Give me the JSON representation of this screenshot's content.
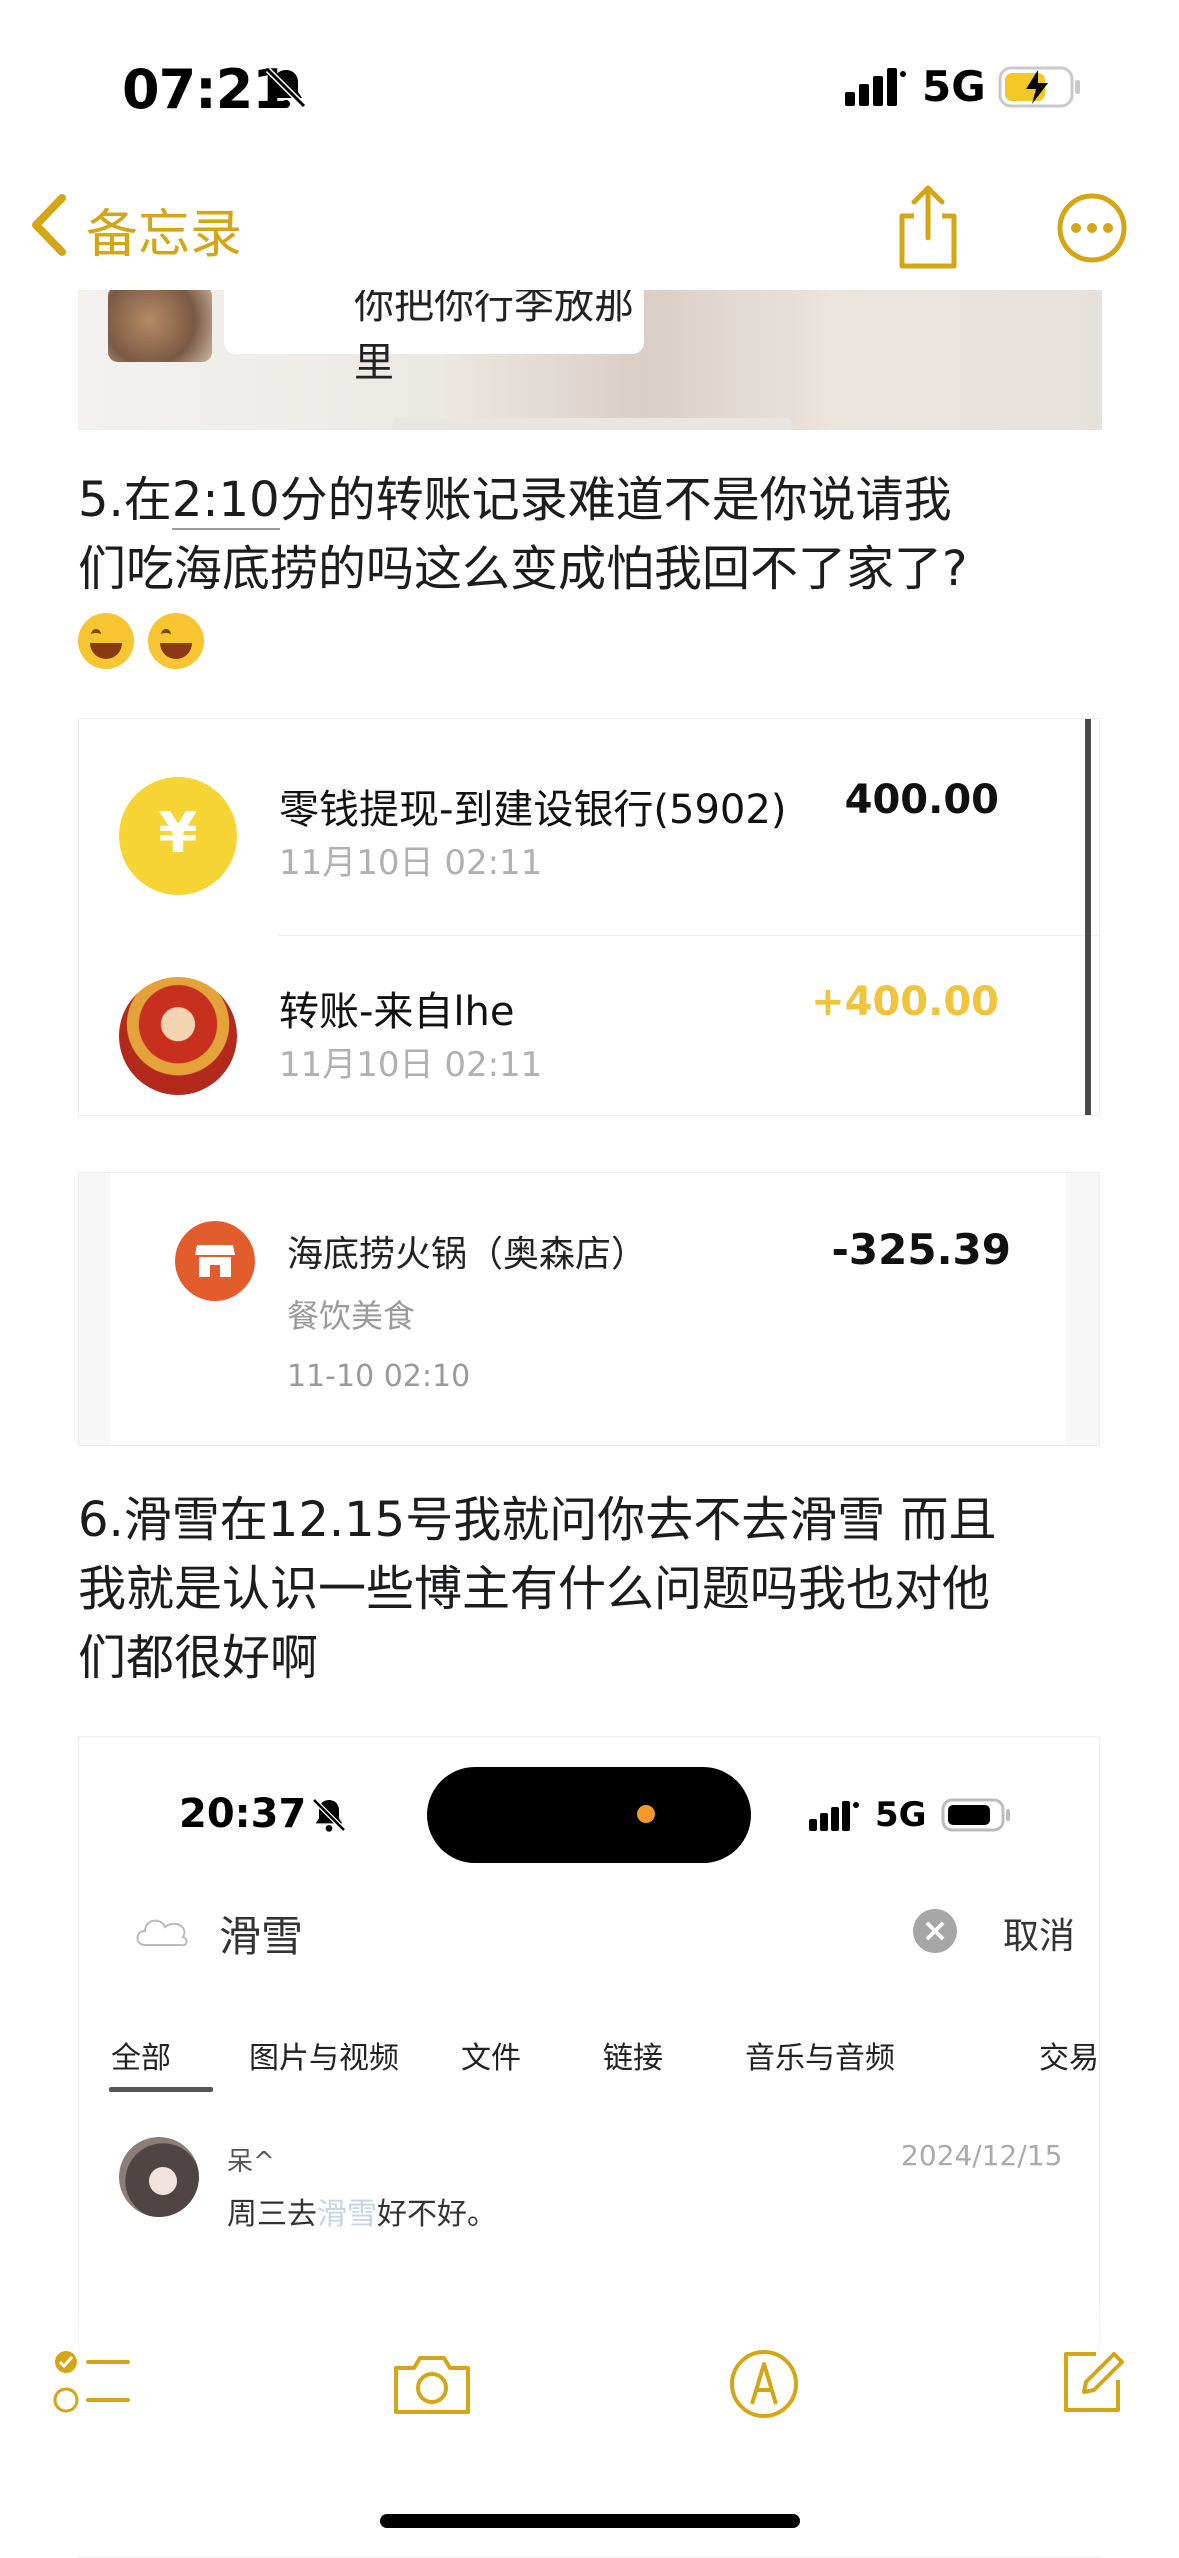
{
  "status_bar": {
    "time": "07:21",
    "network": "5G"
  },
  "nav": {
    "back_label": "备忘录"
  },
  "top_image": {
    "bubble_text": "你把你行李放那里"
  },
  "note": {
    "p5_prefix": "5.在",
    "p5_time": "2:10",
    "p5_rest": "分的转账记录难道不是你说请我",
    "p5_line2": "们吃海底捞的吗这么变成怕我回不了家了?",
    "p6_line1": "6.滑雪在12.15号我就问你去不去滑雪 而且",
    "p6_line2": "我就是认识一些博主有什么问题吗我也对他",
    "p6_line3": "们都很好啊"
  },
  "transactions": [
    {
      "title": "零钱提现-到建设银行(5902)",
      "date": "11月10日 02:11",
      "amount": "400.00"
    },
    {
      "title": "转账-来自lhe",
      "date": "11月10日 02:11",
      "amount": "+400.00"
    }
  ],
  "coin_symbol": "¥",
  "payment": {
    "merchant": "海底捞火锅（奥森店）",
    "category": "餐饮美食",
    "time": "11-10 02:10",
    "amount": "-325.39"
  },
  "screenshot": {
    "time": "20:37",
    "network": "5G",
    "query": "滑雪",
    "cancel_label": "取消",
    "tabs": [
      "全部",
      "图片与视频",
      "文件",
      "链接",
      "音乐与音频",
      "交易"
    ],
    "result": {
      "name": "呆^",
      "date": "2024/12/15",
      "msg_before": "周三去",
      "msg_highlight": "滑雪",
      "msg_after": "好不好。"
    }
  },
  "colors": {
    "accent": "#d4a514",
    "positive_amount": "#f0c43c",
    "store_icon": "#e35d2c"
  }
}
